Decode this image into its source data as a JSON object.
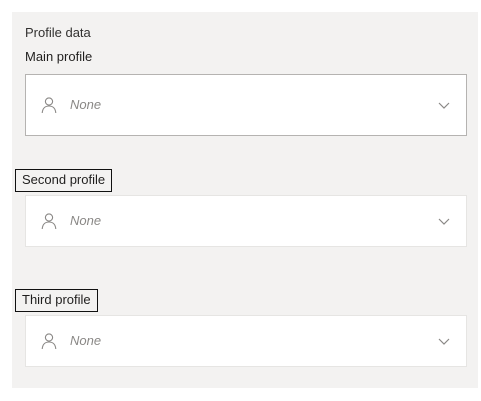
{
  "section": {
    "title": "Profile data"
  },
  "fields": [
    {
      "label": "Main profile",
      "value": "None",
      "icon": "person-icon",
      "dropdown_icon": "chevron-down-icon",
      "highlighted": false
    },
    {
      "label": "Second profile",
      "value": "None",
      "icon": "person-icon",
      "dropdown_icon": "chevron-down-icon",
      "highlighted": true
    },
    {
      "label": "Third profile",
      "value": "None",
      "icon": "person-icon",
      "dropdown_icon": "chevron-down-icon",
      "highlighted": true
    }
  ],
  "colors": {
    "panel_bg": "#f3f2f1",
    "placeholder_text": "#8a8886",
    "highlight_border": "#111111"
  }
}
